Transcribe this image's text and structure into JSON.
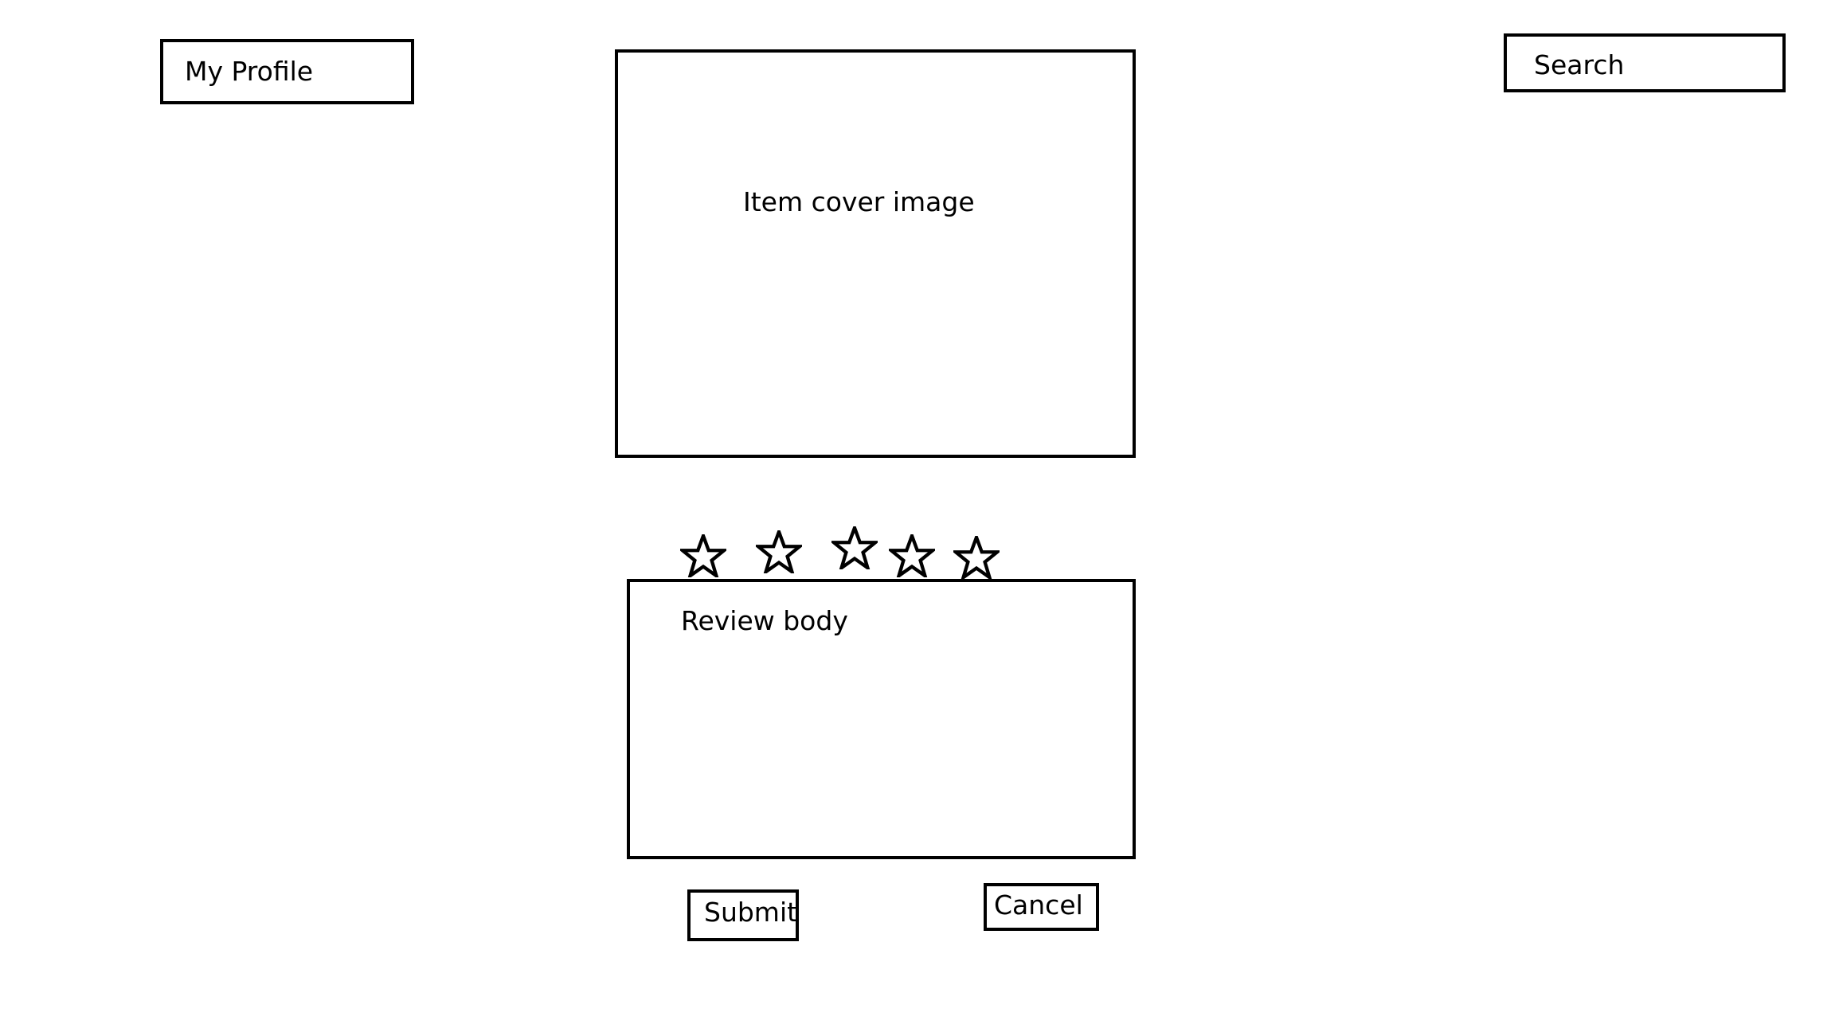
{
  "header": {
    "profile_label": "My Profile",
    "search_label": "Search"
  },
  "item": {
    "cover_label": "Item cover image"
  },
  "rating": {
    "max_stars": 5,
    "selected_stars": 0,
    "icon": "star-outline-icon"
  },
  "review": {
    "body_placeholder": "Review body"
  },
  "actions": {
    "submit_label": "Submit",
    "cancel_label": "Cancel"
  },
  "colors": {
    "stroke": "#000000",
    "background": "#ffffff"
  }
}
